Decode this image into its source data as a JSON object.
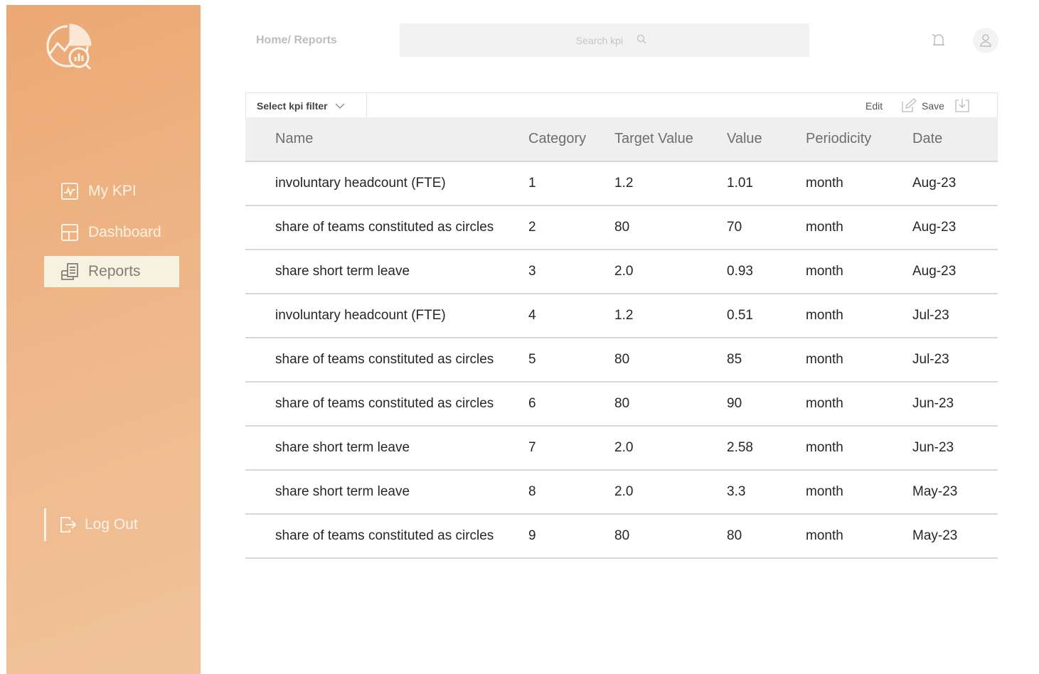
{
  "breadcrumb": "Home/ Reports",
  "search": {
    "placeholder": "Search kpi"
  },
  "sidebar": {
    "items": [
      {
        "label": "My KPI",
        "icon": "chart-pulse-icon"
      },
      {
        "label": "Dashboard",
        "icon": "layout-icon"
      },
      {
        "label": "Reports",
        "icon": "report-icon",
        "active": true
      }
    ],
    "logout": "Log Out"
  },
  "toolbar": {
    "filter": "Select kpi filter",
    "edit": "Edit",
    "save": "Save"
  },
  "table": {
    "columns": [
      "Name",
      "Category",
      "Target Value",
      "Value",
      "Periodicity",
      "Date"
    ],
    "rows": [
      [
        "involuntary headcount (FTE)",
        "1",
        "1.2",
        "1.01",
        "month",
        "Aug-23"
      ],
      [
        "share of teams constituted as circles",
        "2",
        "80",
        "70",
        "month",
        "Aug-23"
      ],
      [
        "share short term leave",
        "3",
        "2.0",
        "0.93",
        "month",
        "Aug-23"
      ],
      [
        "involuntary headcount (FTE)",
        "4",
        "1.2",
        "0.51",
        "month",
        "Jul-23"
      ],
      [
        "share of teams constituted as circles",
        "5",
        "80",
        "85",
        "month",
        "Jul-23"
      ],
      [
        "share of teams constituted as circles",
        "6",
        "80",
        "90",
        "month",
        "Jun-23"
      ],
      [
        "share short term leave",
        "7",
        "2.0",
        "2.58",
        "month",
        "Jun-23"
      ],
      [
        "share short term leave",
        "8",
        "2.0",
        "3.3",
        "month",
        "May-23"
      ],
      [
        "share of teams constituted as circles",
        "9",
        "80",
        "80",
        "month",
        "May-23"
      ]
    ]
  },
  "colors": {
    "sidebar": "#eca874",
    "active_item": "#f7f1df",
    "header_bg": "#efefef"
  }
}
